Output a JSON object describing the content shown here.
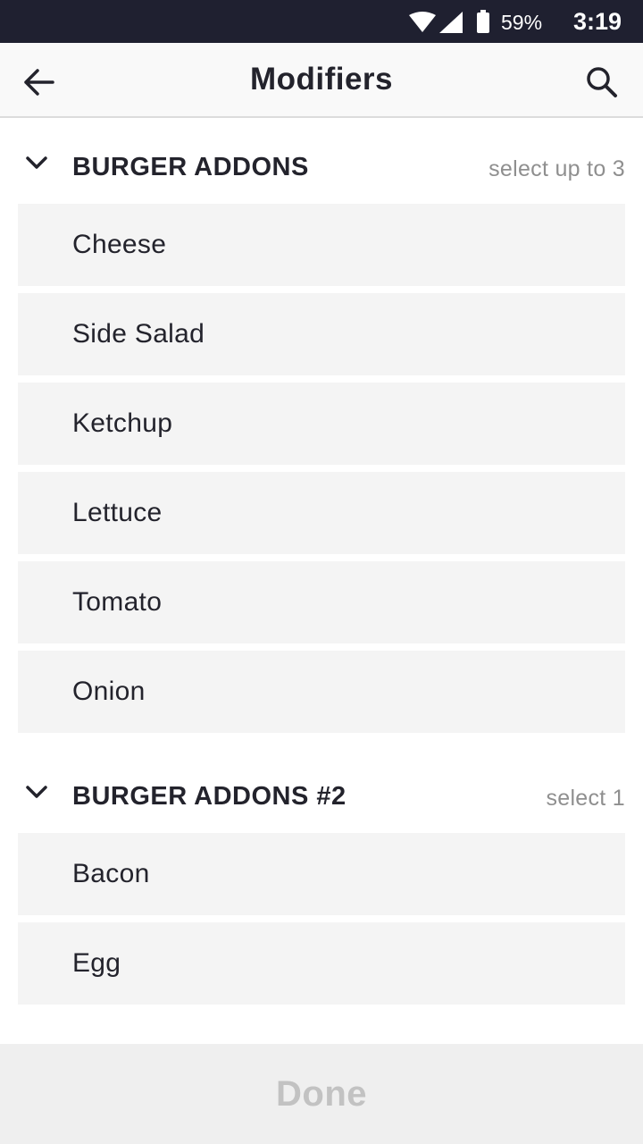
{
  "status_bar": {
    "battery_percent": "59%",
    "time": "3:19"
  },
  "app_bar": {
    "title": "Modifiers",
    "back_icon": "arrow-left-icon",
    "search_icon": "search-icon"
  },
  "sections": [
    {
      "title": "BURGER ADDONS",
      "hint": "select up to 3",
      "items": [
        "Cheese",
        "Side Salad",
        "Ketchup",
        "Lettuce",
        "Tomato",
        "Onion"
      ]
    },
    {
      "title": "BURGER ADDONS #2",
      "hint": "select 1",
      "items": [
        "Bacon",
        "Egg"
      ]
    }
  ],
  "done_label": "Done",
  "colors": {
    "status_bar_bg": "#1f2030",
    "item_bg": "#f4f4f4",
    "text": "#23232c",
    "hint_text": "#8f8f8f",
    "done_disabled_text": "#c2c2c2"
  }
}
